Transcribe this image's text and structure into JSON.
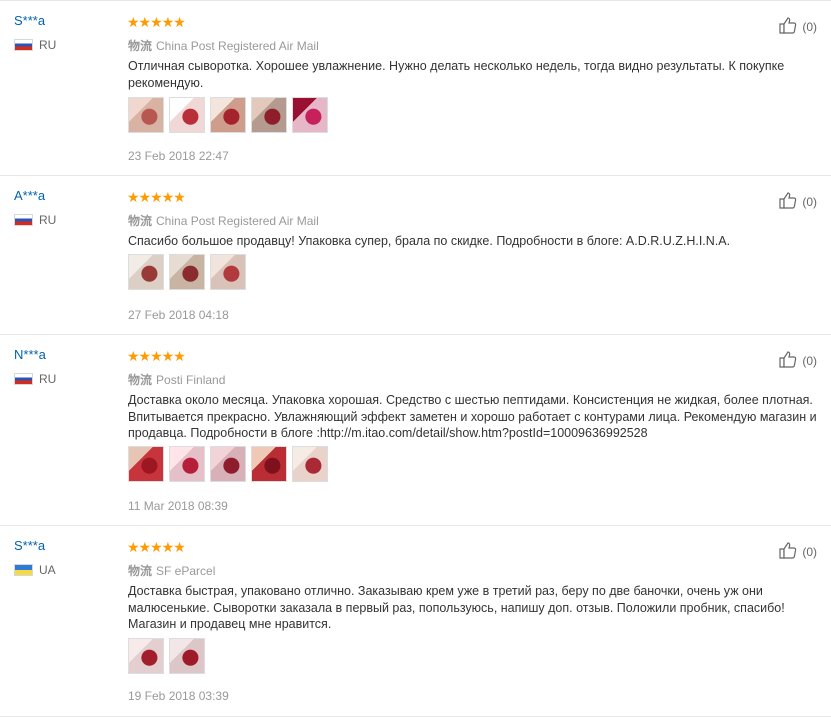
{
  "reviews": [
    {
      "user": "S***a",
      "country": "RU",
      "stars": "★★★★★",
      "logistics_label": "物流",
      "logistics": "China Post Registered Air Mail",
      "text": "Отличная сыворотка. Хорошее увлажнение. Нужно делать несколько недель, тогда видно результаты. К покупке рекомендую.",
      "date": "23 Feb 2018 22:47",
      "helpful_count": "(0)",
      "thumbs": [
        {
          "name": "photo-1",
          "colors": [
            "#d8b3a3",
            "#b8574f",
            "#f0d8cf"
          ]
        },
        {
          "name": "photo-2",
          "colors": [
            "#efd8d6",
            "#b82f3a",
            "#ffffff"
          ]
        },
        {
          "name": "photo-3",
          "colors": [
            "#cf9d8c",
            "#a5232d",
            "#f2e5dc"
          ]
        },
        {
          "name": "photo-4",
          "colors": [
            "#b59a8f",
            "#8e1e2a",
            "#e3c9bc"
          ]
        },
        {
          "name": "photo-5",
          "colors": [
            "#e5b7c7",
            "#c7215b",
            "#9a1033"
          ]
        }
      ]
    },
    {
      "user": "A***a",
      "country": "RU",
      "stars": "★★★★★",
      "logistics_label": "物流",
      "logistics": "China Post Registered Air Mail",
      "text": "Спасибо большое продавцу! Упаковка супер, брала по скидке. Подробности в блоге: A.D.R.U.Z.H.I.N.A.",
      "date": "27 Feb 2018 04:18",
      "helpful_count": "(0)",
      "thumbs": [
        {
          "name": "photo-1",
          "colors": [
            "#dccfc6",
            "#9a3a36",
            "#f2ece6"
          ]
        },
        {
          "name": "photo-2",
          "colors": [
            "#c9b4a3",
            "#8a2b2f",
            "#e7dcd2"
          ]
        },
        {
          "name": "photo-3",
          "colors": [
            "#d9c2b7",
            "#b23a3f",
            "#f1e4dc"
          ]
        }
      ]
    },
    {
      "user": "N***a",
      "country": "RU",
      "stars": "★★★★★",
      "logistics_label": "物流",
      "logistics": "Posti Finland",
      "text": "Доставка около месяца. Упаковка хорошая. Средство с шестью пептидами. Консистенция не жидкая, более плотная. Впитывается прекрасно. Увлажняющий эффект заметен и хорошо работает с контурами лица. Рекомендую магазин и продавца. Подробности в блоге :http://m.itao.com/detail/show.htm?postId=10009636992528",
      "date": "11 Mar 2018 08:39",
      "helpful_count": "(0)",
      "thumbs": [
        {
          "name": "photo-1",
          "colors": [
            "#c7343b",
            "#9c1722",
            "#e7c5b4"
          ]
        },
        {
          "name": "photo-2",
          "colors": [
            "#e6c0c8",
            "#b51f3a",
            "#ffe4ea"
          ]
        },
        {
          "name": "photo-3",
          "colors": [
            "#d8b1b8",
            "#8e1c2c",
            "#f2d4d8"
          ]
        },
        {
          "name": "photo-4",
          "colors": [
            "#bb2d35",
            "#7f111c",
            "#f0c9b6"
          ]
        },
        {
          "name": "photo-5",
          "colors": [
            "#e8d2c9",
            "#a92a35",
            "#f6ece6"
          ]
        }
      ]
    },
    {
      "user": "S***a",
      "country": "UA",
      "stars": "★★★★★",
      "logistics_label": "物流",
      "logistics": "SF eParcel",
      "text": "Доставка быстрая, упаковано отлично. Заказываю крем уже в третий раз, беру по две баночки, очень уж они малюсенькие. Сыворотки заказала в первый раз, попользуюсь, напишу доп. отзыв. Положили пробник, спасибо! Магазин и продавец мне нравится.",
      "date": "19 Feb 2018 03:39",
      "helpful_count": "(0)",
      "thumbs": [
        {
          "name": "photo-1",
          "colors": [
            "#e3cfcf",
            "#a31e2b",
            "#f6eaea"
          ]
        },
        {
          "name": "photo-2",
          "colors": [
            "#dcc6c7",
            "#9e1a28",
            "#f3e6e6"
          ]
        }
      ]
    }
  ]
}
